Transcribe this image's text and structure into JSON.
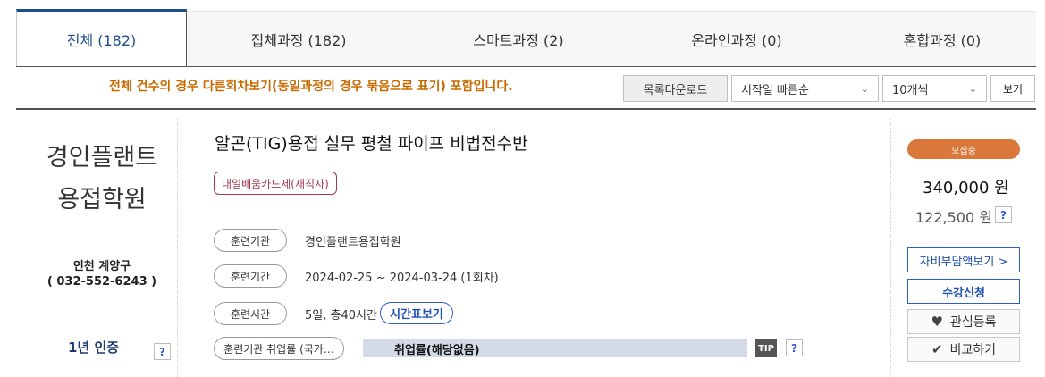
{
  "tabs": [
    {
      "label": "전체 (182)"
    },
    {
      "label": "집체과정 (182)"
    },
    {
      "label": "스마트과정 (2)"
    },
    {
      "label": "온라인과정 (0)"
    },
    {
      "label": "혼합과정 (0)"
    }
  ],
  "toolbar": {
    "notice": "전체 건수의 경우 다른회차보기(동일과정의 경우 묶음으로 표기) 포함입니다.",
    "download_label": "목록다운로드",
    "sort_selected": "시작일 빠른순",
    "page_size_selected": "10개씩",
    "view_label": "보기"
  },
  "course": {
    "org_name_line1": "경인플랜트",
    "org_name_line2": "용접학원",
    "location": "인천 계양구",
    "phone": "( 032-552-6243 )",
    "certification": "1년 인증",
    "title": "알곤(TIG)용접 실무 평철 파이프 비법전수반",
    "card_badge": "내일배움카드제(재직자)",
    "info": [
      {
        "label": "훈련기관",
        "value": "경인플랜트용접학원"
      },
      {
        "label": "훈련기간",
        "value": "2024-02-25 ~ 2024-03-24 (1회차)"
      },
      {
        "label": "훈련시간",
        "value": "5일, 총40시간"
      }
    ],
    "timetable_label": "시간표보기",
    "employment_label": "훈련기관 취업률 (국가…",
    "employment_value": "취업률(해당없음)",
    "tip_label": "TIP",
    "status": "모집중",
    "price": "340,000 원",
    "self_pay": "122,500 원",
    "self_pay_button": "자비부담액보기 >",
    "enroll_button": "수강신청",
    "wishlist_button": "관심등록",
    "compare_button": "비교하기",
    "help_mark": "?"
  }
}
